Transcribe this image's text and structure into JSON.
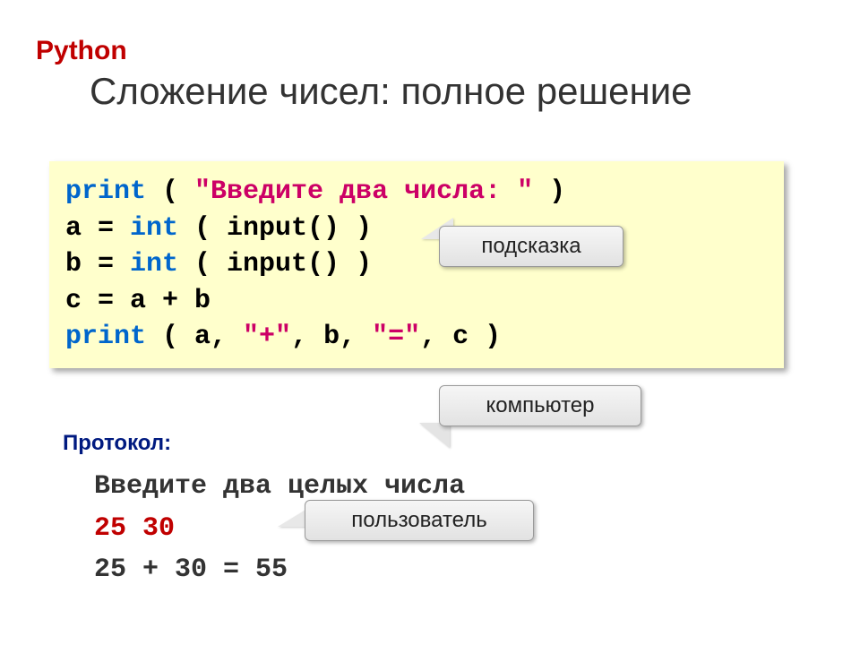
{
  "lang": "Python",
  "title": "Сложение чисел: полное решение",
  "code": {
    "l1_kw": "print",
    "l1_open": " ( ",
    "l1_str": "\"Введите два числа: \"",
    "l1_close": " )",
    "l2_pre": "a = ",
    "l2_kw": "int",
    "l2_rest": " ( input() )",
    "l3_pre": "b = ",
    "l3_kw": "int",
    "l3_rest": " ( input() )",
    "l4": "c = a + b",
    "l5_kw": "print",
    "l5_open": " ( a, ",
    "l5_s1": "\"+\"",
    "l5_mid1": ", b, ",
    "l5_s2": "\"=\"",
    "l5_close": ", c )"
  },
  "callouts": {
    "hint": "подсказка",
    "computer": "компьютер",
    "user": "пользователь"
  },
  "protocol_label": "Протокол:",
  "output": {
    "prompt": "Введите два целых числа",
    "user_input": "25 30",
    "result": "25 + 30 = 55"
  }
}
